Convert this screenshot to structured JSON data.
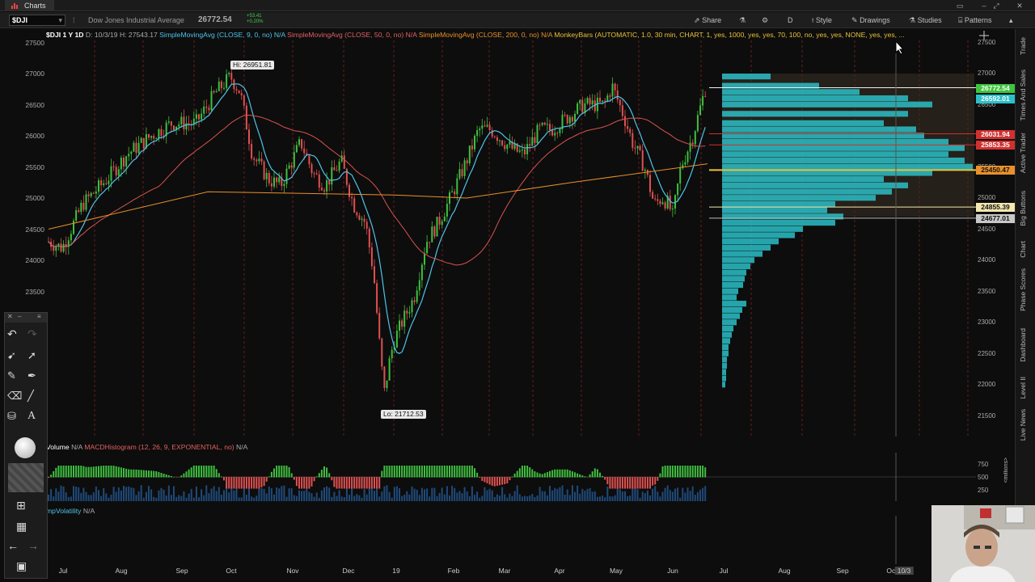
{
  "window": {
    "tab_label": "Charts"
  },
  "toolbar": {
    "symbol": "$DJI",
    "description": "Dow Jones Industrial Average",
    "last_price": "26772.54",
    "change_top": "+53.41",
    "change_bottom": "+0.20%",
    "share_label": "Share",
    "d_label": "D",
    "style_label": "Style",
    "drawings_label": "Drawings",
    "studies_label": "Studies",
    "patterns_label": "Patterns"
  },
  "study_line": {
    "symbol_tf": "$DJI 1 Y 1D",
    "ohlc": "D: 10/3/19  H: 27543.17",
    "sma9": "SimpleMovingAvg (CLOSE, 9, 0, no)",
    "sma9_val": "N/A",
    "sma50": "SimpleMovingAvg (CLOSE, 50, 0, no)",
    "sma50_val": "N/A",
    "sma200": "SimpleMovingAvg (CLOSE, 200, 0, no)",
    "sma200_val": "N/A",
    "monkey": "MonkeyBars (AUTOMATIC, 1.0, 30 min, CHART, 1, yes, 1000, yes, yes, 70, 100, no, yes, yes, NONE, yes, yes, ..."
  },
  "price_axis": {
    "ticks": [
      "27500",
      "27000",
      "26500",
      "26000",
      "25500",
      "25000",
      "24500",
      "24000",
      "23500",
      "23000",
      "22500",
      "22000",
      "21500"
    ]
  },
  "price_tags": {
    "last": "26772.54",
    "cyan": "26592.01",
    "red1": "26031.94",
    "red2": "25853.35",
    "orange": "25450.47",
    "cream": "24855.39",
    "gray": "24677.01"
  },
  "annotations": {
    "high": "Hi: 26951.81",
    "low": "Lo: 21712.53"
  },
  "volume_header": {
    "volume": "Volume",
    "vol_val": "N/A",
    "macd": "MACDHistogram (12, 26, 9, EXPONENTIAL, no)",
    "macd_val": "N/A"
  },
  "volume_axis": {
    "ticks": [
      "750",
      "500",
      "250"
    ],
    "unit": "<millions>"
  },
  "volatility_header": {
    "label": "mpVolatility",
    "val": "N/A"
  },
  "x_axis": {
    "ticks": [
      "Jul",
      "Aug",
      "Sep",
      "Oct",
      "Nov",
      "Dec",
      "19",
      "Feb",
      "Mar",
      "Apr",
      "May",
      "Jun",
      "Jul",
      "Aug",
      "Sep",
      "Oct"
    ],
    "cursor_date": "10/3"
  },
  "side_tabs": [
    "Trade",
    "Times And Sales",
    "Active Trader",
    "Big Buttons",
    "Chart",
    "Phase Scores",
    "Dashboard",
    "Level II",
    "Live News"
  ],
  "colors": {
    "sma9": "#4fc3e8",
    "sma50": "#d9534f",
    "sma200": "#e8902c",
    "monkey": "#e8c23a",
    "up": "#3fbf3f",
    "down": "#e05050",
    "profile": "#2bc0c8"
  }
}
